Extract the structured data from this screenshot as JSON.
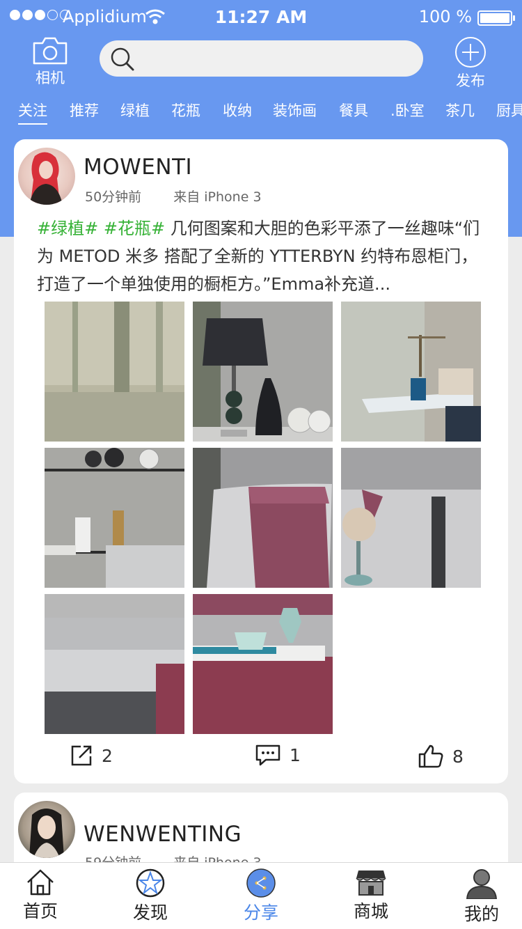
{
  "status": {
    "carrier": "Applidium",
    "time": "11:27 AM",
    "battery": "100 %"
  },
  "header": {
    "camera_label": "相机",
    "publish_label": "发布",
    "search_placeholder": ""
  },
  "tabs": [
    "关注",
    "推荐",
    "绿植",
    "花瓶",
    "收纳",
    "装饰画",
    "餐具",
    ".卧室",
    "茶几",
    "厨具"
  ],
  "posts": [
    {
      "username": "MOWENTI",
      "time": "50分钟前",
      "source": "来自 iPhone 3",
      "tag1": "#绿植#",
      "tag2": "#花瓶#",
      "text": " 几何图案和大胆的色彩平添了一丝趣味“们为 METOD 米多 搭配了全新的 YTTERBYN 约特布恩柜门，打造了一个单独使用的橱柜方。”Emma补充道...",
      "shares": "2",
      "comments": "1",
      "likes": "8"
    },
    {
      "username": "WENWENTING",
      "time": "59分钟前",
      "source": "来自 iPhone 3"
    }
  ],
  "tabbar": {
    "home": "首页",
    "discover": "发现",
    "share": "分享",
    "mall": "商城",
    "mine": "我的"
  },
  "colors": {
    "brand_blue": "#6898f0",
    "tag_green": "#36b236",
    "active_tab": "#4a86e8"
  }
}
